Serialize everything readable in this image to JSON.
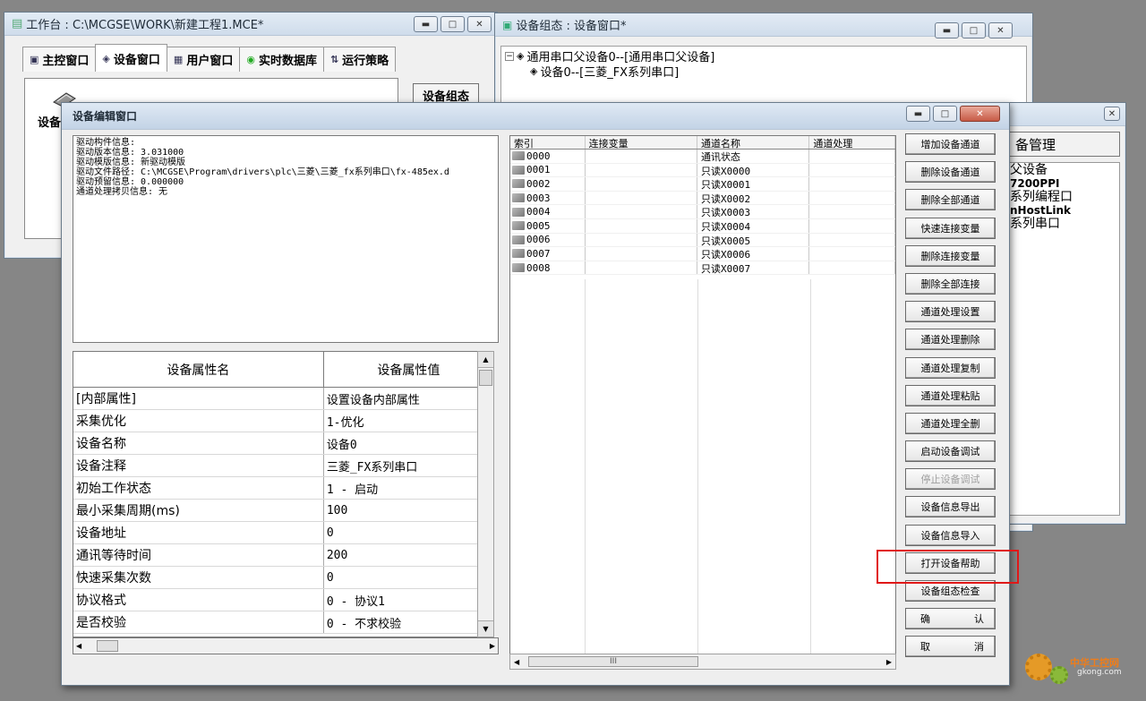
{
  "workbench": {
    "title": "工作台 : C:\\MCGSE\\WORK\\新建工程1.MCE*",
    "tabs": [
      {
        "label": "主控窗口"
      },
      {
        "label": "设备窗口"
      },
      {
        "label": "用户窗口"
      },
      {
        "label": "实时数据库"
      },
      {
        "label": "运行策略"
      }
    ],
    "device_label": "设备",
    "device_config_button": "设备组态"
  },
  "device_config": {
    "title": "设备组态 : 设备窗口*",
    "tree": [
      "通用串口父设备0--[通用串口父设备]",
      "设备0--[三菱_FX系列串口]"
    ]
  },
  "device_manager": {
    "header": "备管理",
    "items": [
      {
        "text": "父设备",
        "bold": false
      },
      {
        "text": "7200PPI",
        "bold": true
      },
      {
        "text": "系列编程口",
        "bold": false
      },
      {
        "text": "nHostLink",
        "bold": true
      },
      {
        "text": "系列串口",
        "bold": false
      }
    ]
  },
  "edit_window": {
    "title": "设备编辑窗口",
    "info_text": "驱动构件信息:\n驱动版本信息: 3.031000\n驱动模版信息: 新驱动模版\n驱动文件路径: C:\\MCGSE\\Program\\drivers\\plc\\三菱\\三菱_fx系列串口\\fx-485ex.d\n驱动预留信息: 0.000000\n通道处理拷贝信息: 无",
    "prop_headers": {
      "name": "设备属性名",
      "value": "设备属性值"
    },
    "props": [
      {
        "name": "[内部属性]",
        "value": "设置设备内部属性"
      },
      {
        "name": "采集优化",
        "value": "1-优化"
      },
      {
        "name": "设备名称",
        "value": "设备0"
      },
      {
        "name": "设备注释",
        "value": "三菱_FX系列串口"
      },
      {
        "name": "初始工作状态",
        "value": "1 - 启动"
      },
      {
        "name": "最小采集周期(ms)",
        "value": "100"
      },
      {
        "name": "设备地址",
        "value": "0"
      },
      {
        "name": "通讯等待时间",
        "value": "200"
      },
      {
        "name": "快速采集次数",
        "value": "0"
      },
      {
        "name": "协议格式",
        "value": "0 - 协议1"
      },
      {
        "name": "是否校验",
        "value": "0 - 不求校验"
      }
    ],
    "channel_headers": [
      "索引",
      "连接变量",
      "通道名称",
      "通道处理"
    ],
    "channels": [
      {
        "index": "0000",
        "var": "",
        "name": "通讯状态",
        "proc": ""
      },
      {
        "index": "0001",
        "var": "",
        "name": "只读X0000",
        "proc": ""
      },
      {
        "index": "0002",
        "var": "",
        "name": "只读X0001",
        "proc": ""
      },
      {
        "index": "0003",
        "var": "",
        "name": "只读X0002",
        "proc": ""
      },
      {
        "index": "0004",
        "var": "",
        "name": "只读X0003",
        "proc": ""
      },
      {
        "index": "0005",
        "var": "",
        "name": "只读X0004",
        "proc": ""
      },
      {
        "index": "0006",
        "var": "",
        "name": "只读X0005",
        "proc": ""
      },
      {
        "index": "0007",
        "var": "",
        "name": "只读X0006",
        "proc": ""
      },
      {
        "index": "0008",
        "var": "",
        "name": "只读X0007",
        "proc": ""
      }
    ],
    "buttons": {
      "add_channel": "增加设备通道",
      "del_channel": "删除设备通道",
      "del_all_channels": "删除全部通道",
      "quick_connect": "快速连接变量",
      "del_connect": "删除连接变量",
      "del_all_connect": "删除全部连接",
      "proc_settings": "通道处理设置",
      "proc_delete": "通道处理删除",
      "proc_copy": "通道处理复制",
      "proc_paste": "通道处理粘贴",
      "proc_delete_all": "通道处理全删",
      "start_debug": "启动设备调试",
      "stop_debug": "停止设备调试",
      "export_info": "设备信息导出",
      "import_info": "设备信息导入",
      "open_help": "打开设备帮助",
      "config_check": "设备组态检查",
      "confirm_a": "确",
      "confirm_b": "认",
      "cancel_a": "取",
      "cancel_b": "消"
    },
    "scroll_thumb_label": "III"
  },
  "watermark": {
    "line1": "中华工控网",
    "line2": "gkong.com"
  },
  "colors": {
    "highlight": "#e01818",
    "close_button": "#c75a45"
  }
}
